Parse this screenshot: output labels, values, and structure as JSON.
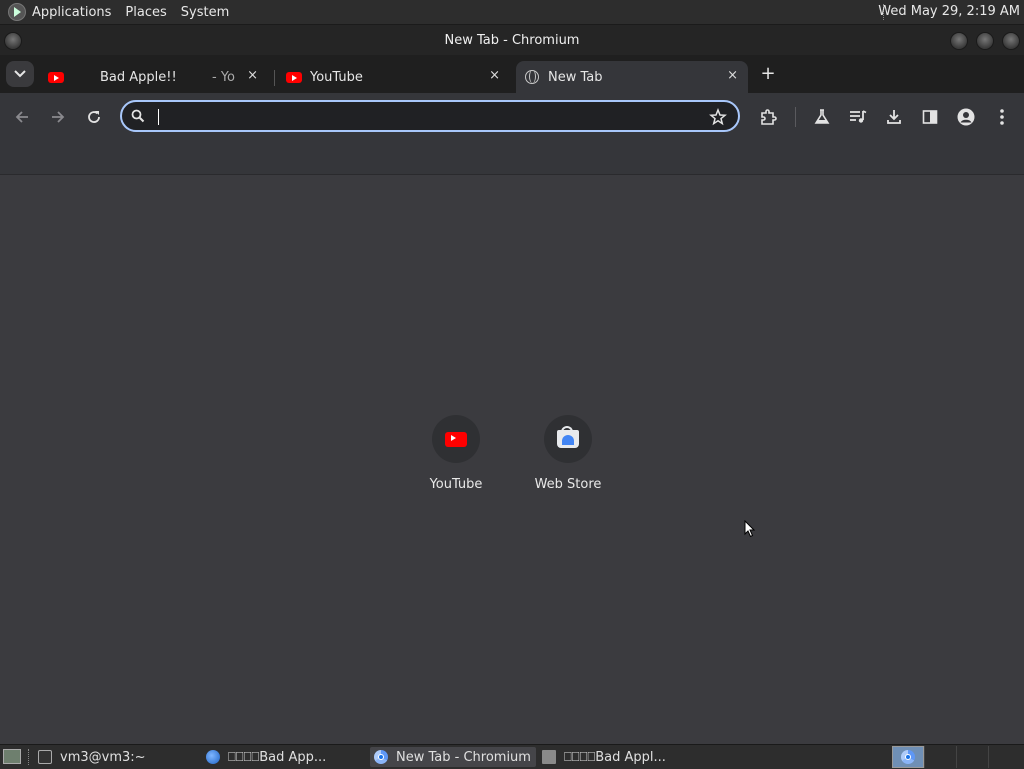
{
  "top_panel": {
    "menus": [
      "Applications",
      "Places",
      "System"
    ],
    "clock": "Wed May 29,  2:19 AM"
  },
  "window": {
    "title": "New Tab - Chromium"
  },
  "tabs": [
    {
      "title": "Bad Apple!!",
      "title_suffix": "- Yo",
      "icon": "youtube-icon",
      "close": "×"
    },
    {
      "title": "YouTube",
      "icon": "youtube-icon",
      "close": "×"
    },
    {
      "title": "New Tab",
      "icon": "globe-icon",
      "close": "×",
      "active": true
    }
  ],
  "tabstrip": {
    "tab_search": "⌄",
    "new_tab": "+"
  },
  "toolbar": {
    "omnibox_value": "",
    "icons": [
      "back-icon",
      "forward-icon",
      "reload-icon",
      "search-icon",
      "star-icon",
      "extensions-icon",
      "labs-icon",
      "media-icon",
      "download-icon",
      "side-panel-icon",
      "profile-icon",
      "menu-icon"
    ]
  },
  "shortcuts": [
    {
      "label": "YouTube",
      "icon": "youtube-icon"
    },
    {
      "label": "Web Store",
      "icon": "web-store-icon"
    }
  ],
  "taskbar": {
    "items": [
      {
        "label": "vm3@vm3:~",
        "icon": "terminal-icon"
      },
      {
        "label": "⎕⎕⎕⎕Bad App...",
        "icon": "browser-icon"
      },
      {
        "label": "New Tab - Chromium",
        "icon": "chromium-icon",
        "active": true
      },
      {
        "label": "⎕⎕⎕⎕Bad Appl...",
        "icon": "folder-icon"
      }
    ]
  },
  "colors": {
    "accent": "#a8c7fa",
    "youtube_red": "#ff0000",
    "background": "#3b3b3f"
  }
}
